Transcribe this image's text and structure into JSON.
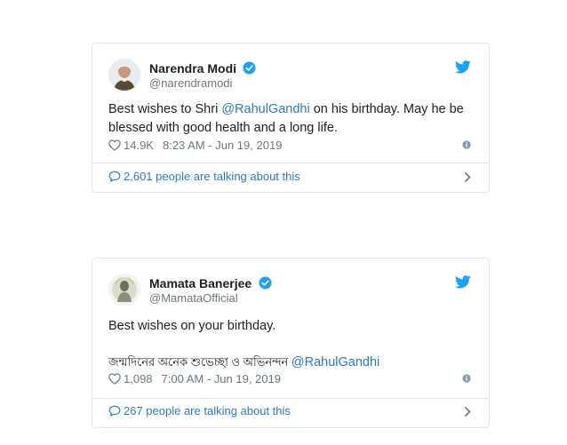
{
  "tweets": [
    {
      "author_name": "Narendra Modi",
      "author_handle": "@narendramodi",
      "verified_icon": "verified-badge",
      "text_before": "Best wishes to Shri ",
      "mention": "@RahulGandhi",
      "text_after": " on his birthday. May he be blessed with good health and a long life.",
      "likes": "14.9K",
      "timestamp": "8:23 AM - Jun 19, 2019",
      "talking": "2,601 people are talking about this"
    },
    {
      "author_name": "Mamata Banerjee",
      "author_handle": "@MamataOfficial",
      "verified_icon": "verified-badge",
      "text_line1": "Best wishes on your birthday.",
      "bengali_text": "জন্মদিনের অনেক শুভেচ্ছা ও অভিনন্দন ",
      "mention": "@RahulGandhi",
      "likes": "1,098",
      "timestamp": "7:00 AM - Jun 19, 2019",
      "talking": "267 people are talking about this"
    }
  ],
  "colors": {
    "twitter_blue": "#1da1f2",
    "link_blue": "#2b7bb9",
    "meta_gray": "#697882",
    "border": "#e1e8ed"
  }
}
